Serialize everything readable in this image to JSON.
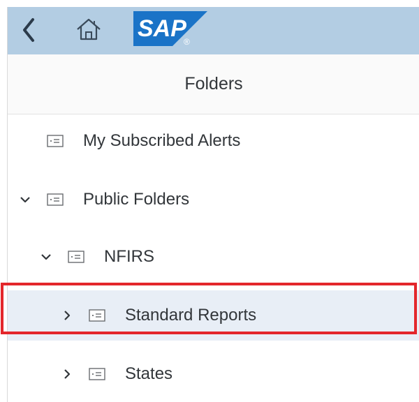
{
  "shellbar": {
    "back_icon": "chevron-left-icon",
    "home_icon": "home-icon",
    "logo_text": "SAP",
    "logo_mark": "®"
  },
  "panel": {
    "title": "Folders"
  },
  "tree": {
    "items": [
      {
        "label": "My Subscribed Alerts",
        "expander": "none",
        "level": 0
      },
      {
        "label": "Public Folders",
        "expander": "expanded",
        "level": 0
      },
      {
        "label": "NFIRS",
        "expander": "expanded",
        "level": 1
      },
      {
        "label": "Standard Reports",
        "expander": "collapsed",
        "level": 2,
        "selected": true
      },
      {
        "label": "States",
        "expander": "collapsed",
        "level": 2
      }
    ]
  },
  "colors": {
    "shellbar_bg": "#b3cde3",
    "logo_blue": "#1a73c7",
    "selection_bg": "#e8eef6",
    "highlight_red": "#e3262b"
  }
}
